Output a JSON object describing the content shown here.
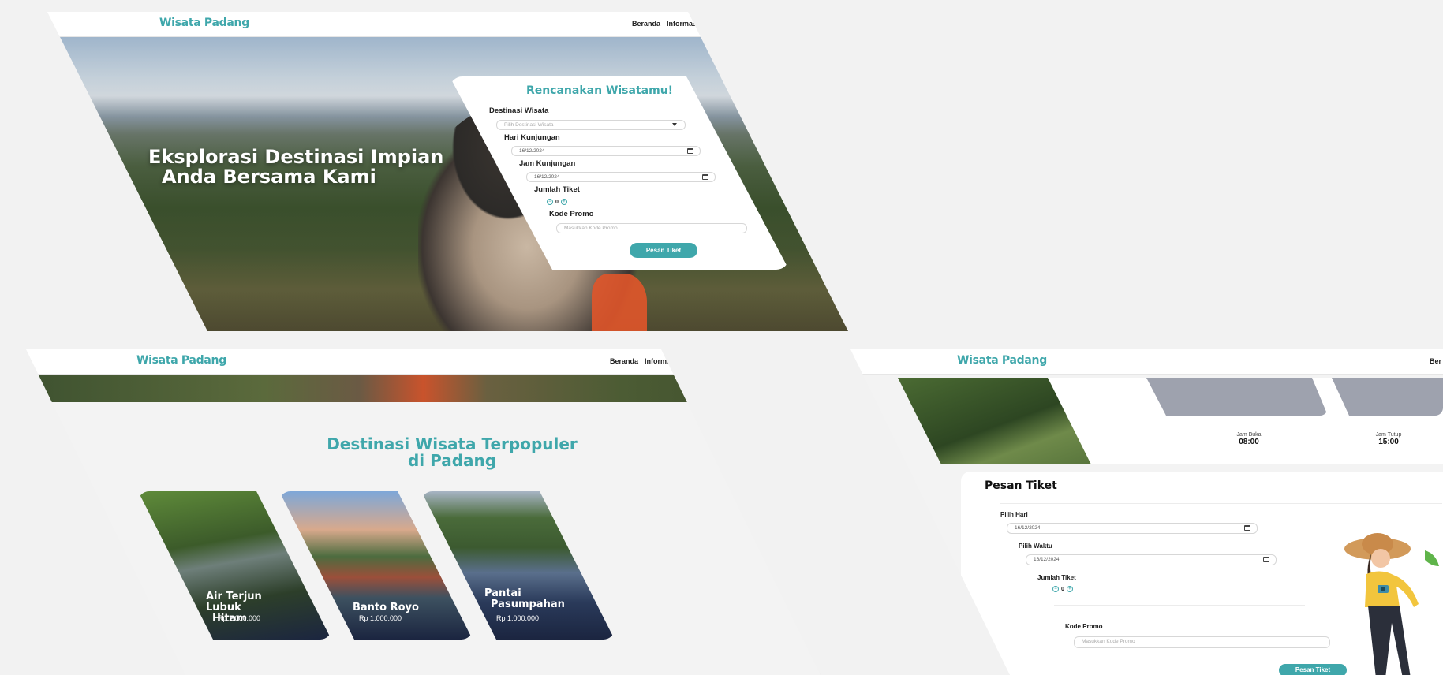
{
  "brand": "Wisata Padang",
  "nav": {
    "home": "Beranda",
    "tickets": "Informasi Tiket",
    "home_partial": "Ber"
  },
  "hero": {
    "title_line1": "Eksplorasi Destinasi Impian",
    "title_line2": "Anda Bersama Kami"
  },
  "plan_form": {
    "title": "Rencanakan Wisatamu!",
    "destination_label": "Destinasi Wisata",
    "destination_placeholder": "Pilih Destinasi Wisata",
    "day_label": "Hari Kunjungan",
    "day_value": "16/12/2024",
    "time_label": "Jam Kunjungan",
    "time_value": "16/12/2024",
    "qty_label": "Jumlah Tiket",
    "qty_value": "0",
    "promo_label": "Kode Promo",
    "promo_placeholder": "Masukkan Kode Promo",
    "submit": "Pesan Tiket"
  },
  "popular": {
    "title_line1": "Destinasi Wisata Terpopuler",
    "title_line2": "di Padang",
    "cards": [
      {
        "name_line1": "Air Terjun Lubuk",
        "name_line2": "Hitam",
        "price": "Rp 1.000.000"
      },
      {
        "name_line1": "Banto Royo",
        "name_line2": "",
        "price": "Rp 1.000.000"
      },
      {
        "name_line1": "Pantai",
        "name_line2": "Pasumpahan",
        "price": "Rp 1.000.000"
      }
    ]
  },
  "detail": {
    "open_label": "Jam Buka",
    "open_value": "08:00",
    "close_label": "Jam Tutup",
    "close_value": "15:00"
  },
  "order_form": {
    "title": "Pesan Tiket",
    "day_label": "Pilih Hari",
    "day_value": "16/12/2024",
    "time_label": "Pilih Waktu",
    "time_value": "16/12/2024",
    "qty_label": "Jumlah Tiket",
    "qty_value": "0",
    "promo_label": "Kode Promo",
    "promo_placeholder": "Masukkan Kode Promo",
    "submit": "Pesan Tiket"
  }
}
